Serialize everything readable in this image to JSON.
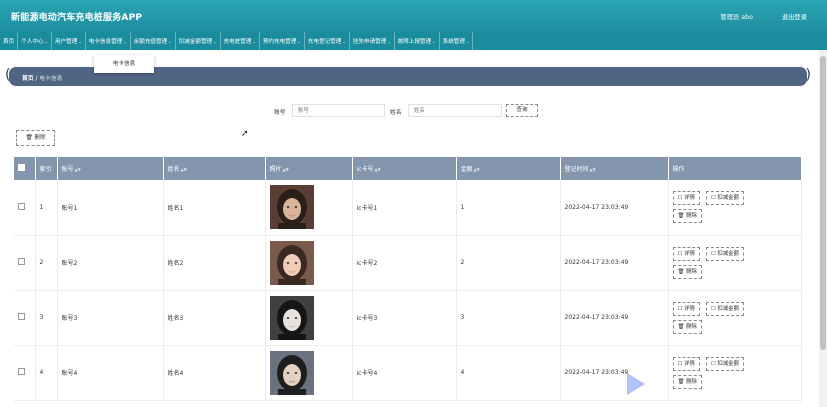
{
  "header": {
    "title": "新能源电动汽车充电桩服务APP",
    "admin": "管理员 abo",
    "logout": "退出登录"
  },
  "nav": [
    {
      "label": "首页",
      "chev": false
    },
    {
      "label": "个人中心",
      "chev": true
    },
    {
      "label": "用户管理",
      "chev": true
    },
    {
      "label": "电卡信息管理",
      "chev": true
    },
    {
      "label": "余额充值管理",
      "chev": true
    },
    {
      "label": "扣减金额管理",
      "chev": true
    },
    {
      "label": "充电桩管理",
      "chev": true
    },
    {
      "label": "预约充电管理",
      "chev": true
    },
    {
      "label": "充电登记管理",
      "chev": true
    },
    {
      "label": "挂失申请管理",
      "chev": true
    },
    {
      "label": "故障上报管理",
      "chev": true
    },
    {
      "label": "系统管理",
      "chev": true
    }
  ],
  "dropdown": {
    "item": "电卡信息"
  },
  "breadcrumb": {
    "home": "首页",
    "sep": "/",
    "current": "电卡信息"
  },
  "search": {
    "account_label": "账号",
    "account_placeholder": "账号",
    "name_label": "姓名",
    "name_placeholder": "姓名",
    "button": "查询"
  },
  "toolbar": {
    "delete": "删除"
  },
  "table": {
    "headers": [
      "索引",
      "账号",
      "姓名",
      "照片",
      "ic卡号",
      "金额",
      "登记时间",
      "操作"
    ],
    "rows": [
      {
        "index": "1",
        "account": "账号1",
        "name": "姓名1",
        "ic": "ic卡号1",
        "amount": "1",
        "time": "2022-04-17 23:03:49"
      },
      {
        "index": "2",
        "account": "账号2",
        "name": "姓名2",
        "ic": "ic卡号2",
        "amount": "2",
        "time": "2022-04-17 23:03:49"
      },
      {
        "index": "3",
        "account": "账号3",
        "name": "姓名3",
        "ic": "ic卡号3",
        "amount": "3",
        "time": "2022-04-17 23:03:49"
      },
      {
        "index": "4",
        "account": "账号4",
        "name": "姓名4",
        "ic": "ic卡号4",
        "amount": "4",
        "time": "2022-04-17 23:03:49"
      }
    ],
    "ops": {
      "detail": "详情",
      "deduct": "扣减金额",
      "delete": "删除"
    }
  },
  "colors": {
    "header": "#1d8fa0",
    "nav": "#1b8c9d",
    "breadcrumb": "#4f6584",
    "table_header": "#8496ad"
  },
  "icons": [
    "delete-icon",
    "detail-icon",
    "deduct-icon",
    "sort-icon",
    "cursor-icon",
    "play-icon"
  ]
}
